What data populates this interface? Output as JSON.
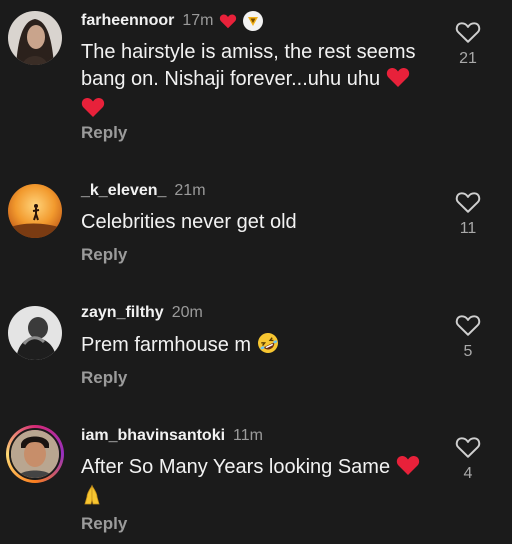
{
  "comments": [
    {
      "username": "farheennoor",
      "time": "17m",
      "text": "The hairstyle is amiss, the rest seems bang on. Nishaji forever...uhu uhu",
      "reply_label": "Reply",
      "likes": "21",
      "avatar": "woman-portrait-avatar"
    },
    {
      "username": "_k_eleven_",
      "time": "21m",
      "text": "Celebrities never get old",
      "reply_label": "Reply",
      "likes": "11",
      "avatar": "sunset-silhouette-avatar"
    },
    {
      "username": "zayn_filthy",
      "time": "20m",
      "text": "Prem farmhouse m",
      "reply_label": "Reply",
      "likes": "5",
      "avatar": "bw-figure-avatar"
    },
    {
      "username": "iam_bhavinsantoki",
      "time": "11m",
      "text": "After So Many Years looking Same",
      "reply_label": "Reply",
      "likes": "4",
      "avatar": "man-selfie-avatar"
    }
  ],
  "colors": {
    "background": "#1b1b1b",
    "heart_red": "#e8213a",
    "muted_text": "#9b9b9b"
  }
}
